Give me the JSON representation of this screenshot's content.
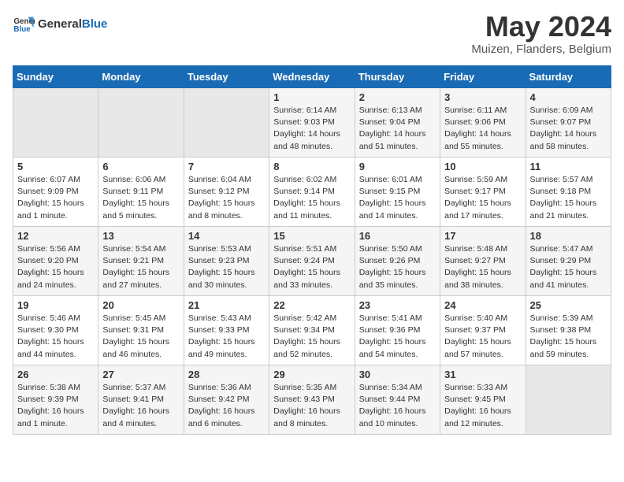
{
  "header": {
    "logo_line1": "General",
    "logo_line2": "Blue",
    "month_year": "May 2024",
    "location": "Muizen, Flanders, Belgium"
  },
  "days_of_week": [
    "Sunday",
    "Monday",
    "Tuesday",
    "Wednesday",
    "Thursday",
    "Friday",
    "Saturday"
  ],
  "weeks": [
    [
      {
        "num": "",
        "info": ""
      },
      {
        "num": "",
        "info": ""
      },
      {
        "num": "",
        "info": ""
      },
      {
        "num": "1",
        "info": "Sunrise: 6:14 AM\nSunset: 9:03 PM\nDaylight: 14 hours\nand 48 minutes."
      },
      {
        "num": "2",
        "info": "Sunrise: 6:13 AM\nSunset: 9:04 PM\nDaylight: 14 hours\nand 51 minutes."
      },
      {
        "num": "3",
        "info": "Sunrise: 6:11 AM\nSunset: 9:06 PM\nDaylight: 14 hours\nand 55 minutes."
      },
      {
        "num": "4",
        "info": "Sunrise: 6:09 AM\nSunset: 9:07 PM\nDaylight: 14 hours\nand 58 minutes."
      }
    ],
    [
      {
        "num": "5",
        "info": "Sunrise: 6:07 AM\nSunset: 9:09 PM\nDaylight: 15 hours\nand 1 minute."
      },
      {
        "num": "6",
        "info": "Sunrise: 6:06 AM\nSunset: 9:11 PM\nDaylight: 15 hours\nand 5 minutes."
      },
      {
        "num": "7",
        "info": "Sunrise: 6:04 AM\nSunset: 9:12 PM\nDaylight: 15 hours\nand 8 minutes."
      },
      {
        "num": "8",
        "info": "Sunrise: 6:02 AM\nSunset: 9:14 PM\nDaylight: 15 hours\nand 11 minutes."
      },
      {
        "num": "9",
        "info": "Sunrise: 6:01 AM\nSunset: 9:15 PM\nDaylight: 15 hours\nand 14 minutes."
      },
      {
        "num": "10",
        "info": "Sunrise: 5:59 AM\nSunset: 9:17 PM\nDaylight: 15 hours\nand 17 minutes."
      },
      {
        "num": "11",
        "info": "Sunrise: 5:57 AM\nSunset: 9:18 PM\nDaylight: 15 hours\nand 21 minutes."
      }
    ],
    [
      {
        "num": "12",
        "info": "Sunrise: 5:56 AM\nSunset: 9:20 PM\nDaylight: 15 hours\nand 24 minutes."
      },
      {
        "num": "13",
        "info": "Sunrise: 5:54 AM\nSunset: 9:21 PM\nDaylight: 15 hours\nand 27 minutes."
      },
      {
        "num": "14",
        "info": "Sunrise: 5:53 AM\nSunset: 9:23 PM\nDaylight: 15 hours\nand 30 minutes."
      },
      {
        "num": "15",
        "info": "Sunrise: 5:51 AM\nSunset: 9:24 PM\nDaylight: 15 hours\nand 33 minutes."
      },
      {
        "num": "16",
        "info": "Sunrise: 5:50 AM\nSunset: 9:26 PM\nDaylight: 15 hours\nand 35 minutes."
      },
      {
        "num": "17",
        "info": "Sunrise: 5:48 AM\nSunset: 9:27 PM\nDaylight: 15 hours\nand 38 minutes."
      },
      {
        "num": "18",
        "info": "Sunrise: 5:47 AM\nSunset: 9:29 PM\nDaylight: 15 hours\nand 41 minutes."
      }
    ],
    [
      {
        "num": "19",
        "info": "Sunrise: 5:46 AM\nSunset: 9:30 PM\nDaylight: 15 hours\nand 44 minutes."
      },
      {
        "num": "20",
        "info": "Sunrise: 5:45 AM\nSunset: 9:31 PM\nDaylight: 15 hours\nand 46 minutes."
      },
      {
        "num": "21",
        "info": "Sunrise: 5:43 AM\nSunset: 9:33 PM\nDaylight: 15 hours\nand 49 minutes."
      },
      {
        "num": "22",
        "info": "Sunrise: 5:42 AM\nSunset: 9:34 PM\nDaylight: 15 hours\nand 52 minutes."
      },
      {
        "num": "23",
        "info": "Sunrise: 5:41 AM\nSunset: 9:36 PM\nDaylight: 15 hours\nand 54 minutes."
      },
      {
        "num": "24",
        "info": "Sunrise: 5:40 AM\nSunset: 9:37 PM\nDaylight: 15 hours\nand 57 minutes."
      },
      {
        "num": "25",
        "info": "Sunrise: 5:39 AM\nSunset: 9:38 PM\nDaylight: 15 hours\nand 59 minutes."
      }
    ],
    [
      {
        "num": "26",
        "info": "Sunrise: 5:38 AM\nSunset: 9:39 PM\nDaylight: 16 hours\nand 1 minute."
      },
      {
        "num": "27",
        "info": "Sunrise: 5:37 AM\nSunset: 9:41 PM\nDaylight: 16 hours\nand 4 minutes."
      },
      {
        "num": "28",
        "info": "Sunrise: 5:36 AM\nSunset: 9:42 PM\nDaylight: 16 hours\nand 6 minutes."
      },
      {
        "num": "29",
        "info": "Sunrise: 5:35 AM\nSunset: 9:43 PM\nDaylight: 16 hours\nand 8 minutes."
      },
      {
        "num": "30",
        "info": "Sunrise: 5:34 AM\nSunset: 9:44 PM\nDaylight: 16 hours\nand 10 minutes."
      },
      {
        "num": "31",
        "info": "Sunrise: 5:33 AM\nSunset: 9:45 PM\nDaylight: 16 hours\nand 12 minutes."
      },
      {
        "num": "",
        "info": ""
      }
    ]
  ]
}
